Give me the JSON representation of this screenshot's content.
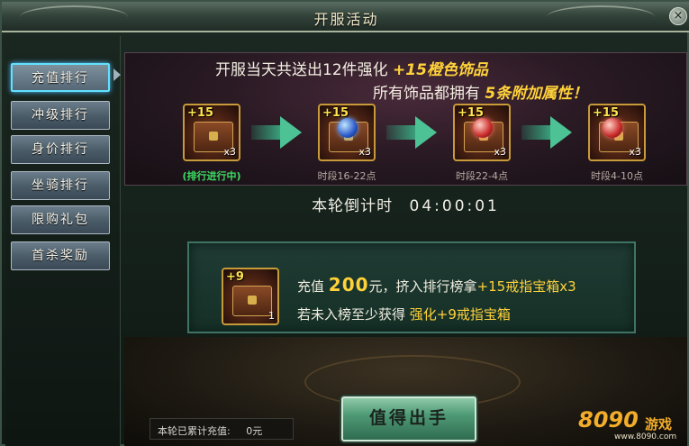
{
  "window": {
    "title": "开服活动",
    "close_label": "×"
  },
  "sidebar": {
    "items": [
      {
        "label": "充值排行",
        "active": true
      },
      {
        "label": "冲级排行"
      },
      {
        "label": "身价排行"
      },
      {
        "label": "坐骑排行"
      },
      {
        "label": "限购礼包"
      },
      {
        "label": "首杀奖励"
      }
    ]
  },
  "banner": {
    "line1_prefix": "开服当天共送出12件强化",
    "line1_highlight": "+15橙色饰品",
    "line2_prefix": "所有饰品都拥有",
    "line2_highlight": "5条附加属性！",
    "stages": [
      {
        "plus": "+15",
        "qty": "x3",
        "label": "(排行进行中)",
        "icon": "ring-chest-icon"
      },
      {
        "plus": "+15",
        "qty": "x3",
        "label": "时段16-22点",
        "icon": "necklace-chest-icon"
      },
      {
        "plus": "+15",
        "qty": "x3",
        "label": "时段22-4点",
        "icon": "amulet-chest-icon"
      },
      {
        "plus": "+15",
        "qty": "x3",
        "label": "时段4-10点",
        "icon": "earring-chest-icon"
      }
    ]
  },
  "countdown": {
    "label": "本轮倒计时",
    "time": "04:00:01"
  },
  "reward": {
    "item_plus": "+9",
    "item_qty": "1",
    "line1_a": "充值",
    "line1_amount": "200",
    "line1_b": "元，挤入排行榜拿",
    "line1_prize": "+15戒指宝箱x3",
    "line2_a": "若未入榜至少获得",
    "line2_prize": "强化+9戒指宝箱"
  },
  "total": {
    "label": "本轮已累计充值:",
    "value": "0元"
  },
  "buy_button": "值得出手",
  "watermark": {
    "logo": "8090",
    "cn": "游戏",
    "url": "www.8090.com"
  }
}
